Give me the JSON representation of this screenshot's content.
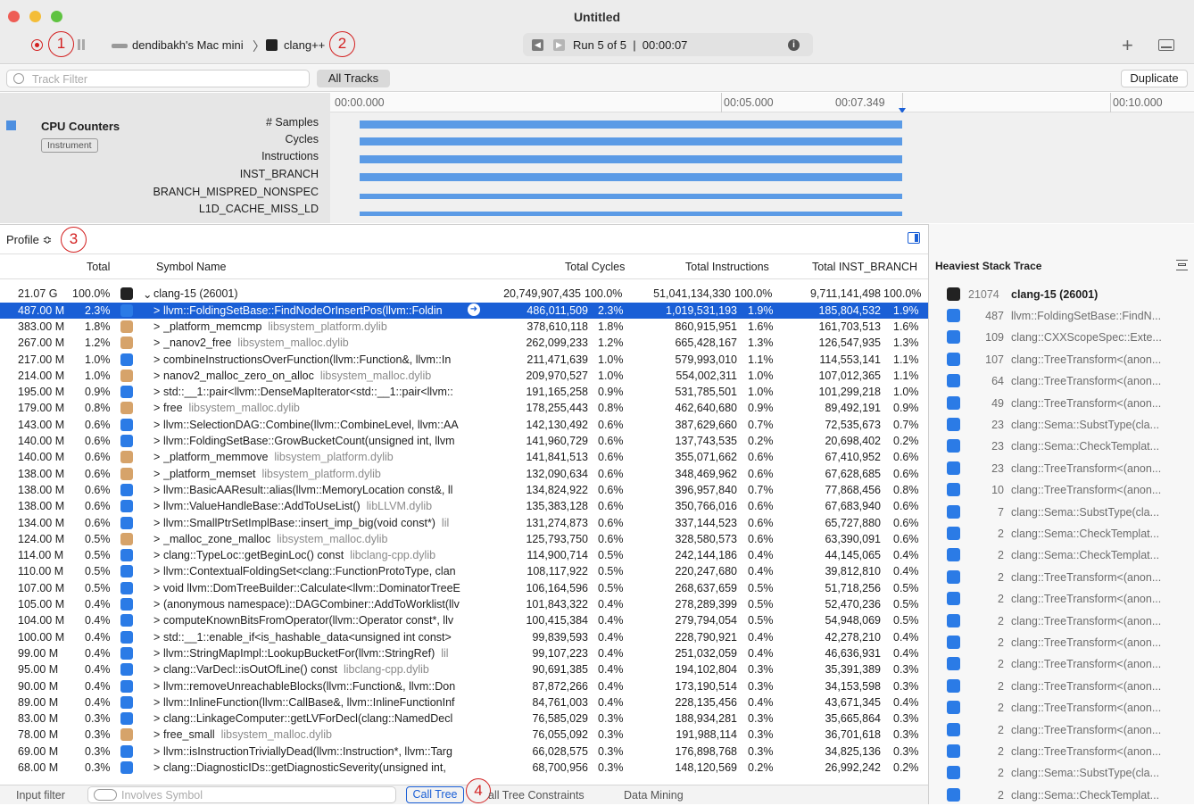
{
  "window": {
    "title": "Untitled"
  },
  "toolbar": {
    "device": "dendibakh's Mac mini",
    "target": "clang++",
    "run_status": "Run 5 of 5  |  00:00:07",
    "add": "+",
    "annot1": "1",
    "annot2": "2"
  },
  "filter": {
    "placeholder": "Track Filter",
    "all_tracks": "All Tracks",
    "duplicate": "Duplicate"
  },
  "timeline": {
    "ticks": [
      "00:00.000",
      "00:05.000",
      "00:07.349",
      "00:10.000"
    ],
    "track": {
      "name": "CPU Counters",
      "badge": "Instrument",
      "counters": [
        "# Samples",
        "Cycles",
        "Instructions",
        "INST_BRANCH",
        "BRANCH_MISPRED_NONSPEC",
        "L1D_CACHE_MISS_LD"
      ]
    }
  },
  "profile": {
    "selector": "Profile ≎",
    "annot3": "3"
  },
  "columns": {
    "total": "Total",
    "symbol": "Symbol Name",
    "cycles": "Total Cycles",
    "instructions": "Total Instructions",
    "branch": "Total INST_BRANCH"
  },
  "root": {
    "total": "21.07 G",
    "pct": "100.0%",
    "symbol": "clang-15 (26001)",
    "cycles": "20,749,907,435",
    "cycles_pct": "100.0%",
    "instr": "51,041,134,330",
    "instr_pct": "100.0%",
    "branch": "9,711,141,498",
    "branch_pct": "100.0%"
  },
  "rows": [
    {
      "total": "487.00 M",
      "pct": "2.3%",
      "icon": "user",
      "sym": "llvm::FoldingSetBase::FindNodeOrInsertPos(llvm::Foldin",
      "lib": "",
      "cyc": "486,011,509",
      "cp": "2.3%",
      "ins": "1,019,531,193",
      "ip": "1.9%",
      "br": "185,804,532",
      "bp": "1.9%"
    },
    {
      "total": "383.00 M",
      "pct": "1.8%",
      "icon": "sys",
      "sym": "_platform_memcmp",
      "lib": "libsystem_platform.dylib",
      "cyc": "378,610,118",
      "cp": "1.8%",
      "ins": "860,915,951",
      "ip": "1.6%",
      "br": "161,703,513",
      "bp": "1.6%"
    },
    {
      "total": "267.00 M",
      "pct": "1.2%",
      "icon": "sys",
      "sym": "_nanov2_free",
      "lib": "libsystem_malloc.dylib",
      "cyc": "262,099,233",
      "cp": "1.2%",
      "ins": "665,428,167",
      "ip": "1.3%",
      "br": "126,547,935",
      "bp": "1.3%"
    },
    {
      "total": "217.00 M",
      "pct": "1.0%",
      "icon": "user",
      "sym": "combineInstructionsOverFunction(llvm::Function&, llvm::In",
      "lib": "",
      "cyc": "211,471,639",
      "cp": "1.0%",
      "ins": "579,993,010",
      "ip": "1.1%",
      "br": "114,553,141",
      "bp": "1.1%"
    },
    {
      "total": "214.00 M",
      "pct": "1.0%",
      "icon": "sys",
      "sym": "nanov2_malloc_zero_on_alloc",
      "lib": "libsystem_malloc.dylib",
      "cyc": "209,970,527",
      "cp": "1.0%",
      "ins": "554,002,311",
      "ip": "1.0%",
      "br": "107,012,365",
      "bp": "1.1%"
    },
    {
      "total": "195.00 M",
      "pct": "0.9%",
      "icon": "user",
      "sym": "std::__1::pair<llvm::DenseMapIterator<std::__1::pair<llvm::",
      "lib": "",
      "cyc": "191,165,258",
      "cp": "0.9%",
      "ins": "531,785,501",
      "ip": "1.0%",
      "br": "101,299,218",
      "bp": "1.0%"
    },
    {
      "total": "179.00 M",
      "pct": "0.8%",
      "icon": "sys",
      "sym": "free",
      "lib": "libsystem_malloc.dylib",
      "cyc": "178,255,443",
      "cp": "0.8%",
      "ins": "462,640,680",
      "ip": "0.9%",
      "br": "89,492,191",
      "bp": "0.9%"
    },
    {
      "total": "143.00 M",
      "pct": "0.6%",
      "icon": "user",
      "sym": "llvm::SelectionDAG::Combine(llvm::CombineLevel, llvm::AA",
      "lib": "",
      "cyc": "142,130,492",
      "cp": "0.6%",
      "ins": "387,629,660",
      "ip": "0.7%",
      "br": "72,535,673",
      "bp": "0.7%"
    },
    {
      "total": "140.00 M",
      "pct": "0.6%",
      "icon": "user",
      "sym": "llvm::FoldingSetBase::GrowBucketCount(unsigned int, llvm",
      "lib": "",
      "cyc": "141,960,729",
      "cp": "0.6%",
      "ins": "137,743,535",
      "ip": "0.2%",
      "br": "20,698,402",
      "bp": "0.2%"
    },
    {
      "total": "140.00 M",
      "pct": "0.6%",
      "icon": "sys",
      "sym": "_platform_memmove",
      "lib": "libsystem_platform.dylib",
      "cyc": "141,841,513",
      "cp": "0.6%",
      "ins": "355,071,662",
      "ip": "0.6%",
      "br": "67,410,952",
      "bp": "0.6%"
    },
    {
      "total": "138.00 M",
      "pct": "0.6%",
      "icon": "sys",
      "sym": "_platform_memset",
      "lib": "libsystem_platform.dylib",
      "cyc": "132,090,634",
      "cp": "0.6%",
      "ins": "348,469,962",
      "ip": "0.6%",
      "br": "67,628,685",
      "bp": "0.6%"
    },
    {
      "total": "138.00 M",
      "pct": "0.6%",
      "icon": "user",
      "sym": "llvm::BasicAAResult::alias(llvm::MemoryLocation const&, ll",
      "lib": "",
      "cyc": "134,824,922",
      "cp": "0.6%",
      "ins": "396,957,840",
      "ip": "0.7%",
      "br": "77,868,456",
      "bp": "0.8%"
    },
    {
      "total": "138.00 M",
      "pct": "0.6%",
      "icon": "user",
      "sym": "llvm::ValueHandleBase::AddToUseList()",
      "lib": "libLLVM.dylib",
      "cyc": "135,383,128",
      "cp": "0.6%",
      "ins": "350,766,016",
      "ip": "0.6%",
      "br": "67,683,940",
      "bp": "0.6%"
    },
    {
      "total": "134.00 M",
      "pct": "0.6%",
      "icon": "user",
      "sym": "llvm::SmallPtrSetImplBase::insert_imp_big(void const*)",
      "lib": "lil",
      "cyc": "131,274,873",
      "cp": "0.6%",
      "ins": "337,144,523",
      "ip": "0.6%",
      "br": "65,727,880",
      "bp": "0.6%"
    },
    {
      "total": "124.00 M",
      "pct": "0.5%",
      "icon": "sys",
      "sym": "_malloc_zone_malloc",
      "lib": "libsystem_malloc.dylib",
      "cyc": "125,793,750",
      "cp": "0.6%",
      "ins": "328,580,573",
      "ip": "0.6%",
      "br": "63,390,091",
      "bp": "0.6%"
    },
    {
      "total": "114.00 M",
      "pct": "0.5%",
      "icon": "user",
      "sym": "clang::TypeLoc::getBeginLoc() const",
      "lib": "libclang-cpp.dylib",
      "cyc": "114,900,714",
      "cp": "0.5%",
      "ins": "242,144,186",
      "ip": "0.4%",
      "br": "44,145,065",
      "bp": "0.4%"
    },
    {
      "total": "110.00 M",
      "pct": "0.5%",
      "icon": "user",
      "sym": "llvm::ContextualFoldingSet<clang::FunctionProtoType, clan",
      "lib": "",
      "cyc": "108,117,922",
      "cp": "0.5%",
      "ins": "220,247,680",
      "ip": "0.4%",
      "br": "39,812,810",
      "bp": "0.4%"
    },
    {
      "total": "107.00 M",
      "pct": "0.5%",
      "icon": "user",
      "sym": "void llvm::DomTreeBuilder::Calculate<llvm::DominatorTreeE",
      "lib": "",
      "cyc": "106,164,596",
      "cp": "0.5%",
      "ins": "268,637,659",
      "ip": "0.5%",
      "br": "51,718,256",
      "bp": "0.5%"
    },
    {
      "total": "105.00 M",
      "pct": "0.4%",
      "icon": "user",
      "sym": "(anonymous namespace)::DAGCombiner::AddToWorklist(llv",
      "lib": "",
      "cyc": "101,843,322",
      "cp": "0.4%",
      "ins": "278,289,399",
      "ip": "0.5%",
      "br": "52,470,236",
      "bp": "0.5%"
    },
    {
      "total": "104.00 M",
      "pct": "0.4%",
      "icon": "user",
      "sym": "computeKnownBitsFromOperator(llvm::Operator const*, llv",
      "lib": "",
      "cyc": "100,415,384",
      "cp": "0.4%",
      "ins": "279,794,054",
      "ip": "0.5%",
      "br": "54,948,069",
      "bp": "0.5%"
    },
    {
      "total": "100.00 M",
      "pct": "0.4%",
      "icon": "user",
      "sym": "std::__1::enable_if<is_hashable_data<unsigned int const>",
      "lib": "",
      "cyc": "99,839,593",
      "cp": "0.4%",
      "ins": "228,790,921",
      "ip": "0.4%",
      "br": "42,278,210",
      "bp": "0.4%"
    },
    {
      "total": "99.00 M",
      "pct": "0.4%",
      "icon": "user",
      "sym": "llvm::StringMapImpl::LookupBucketFor(llvm::StringRef)",
      "lib": "lil",
      "cyc": "99,107,223",
      "cp": "0.4%",
      "ins": "251,032,059",
      "ip": "0.4%",
      "br": "46,636,931",
      "bp": "0.4%"
    },
    {
      "total": "95.00 M",
      "pct": "0.4%",
      "icon": "user",
      "sym": "clang::VarDecl::isOutOfLine() const",
      "lib": "libclang-cpp.dylib",
      "cyc": "90,691,385",
      "cp": "0.4%",
      "ins": "194,102,804",
      "ip": "0.3%",
      "br": "35,391,389",
      "bp": "0.3%"
    },
    {
      "total": "90.00 M",
      "pct": "0.4%",
      "icon": "user",
      "sym": "llvm::removeUnreachableBlocks(llvm::Function&, llvm::Don",
      "lib": "",
      "cyc": "87,872,266",
      "cp": "0.4%",
      "ins": "173,190,514",
      "ip": "0.3%",
      "br": "34,153,598",
      "bp": "0.3%"
    },
    {
      "total": "89.00 M",
      "pct": "0.4%",
      "icon": "user",
      "sym": "llvm::InlineFunction(llvm::CallBase&, llvm::InlineFunctionInf",
      "lib": "",
      "cyc": "84,761,003",
      "cp": "0.4%",
      "ins": "228,135,456",
      "ip": "0.4%",
      "br": "43,671,345",
      "bp": "0.4%"
    },
    {
      "total": "83.00 M",
      "pct": "0.3%",
      "icon": "user",
      "sym": "clang::LinkageComputer::getLVForDecl(clang::NamedDecl",
      "lib": "",
      "cyc": "76,585,029",
      "cp": "0.3%",
      "ins": "188,934,281",
      "ip": "0.3%",
      "br": "35,665,864",
      "bp": "0.3%"
    },
    {
      "total": "78.00 M",
      "pct": "0.3%",
      "icon": "sys",
      "sym": "free_small",
      "lib": "libsystem_malloc.dylib",
      "cyc": "76,055,092",
      "cp": "0.3%",
      "ins": "191,988,114",
      "ip": "0.3%",
      "br": "36,701,618",
      "bp": "0.3%"
    },
    {
      "total": "69.00 M",
      "pct": "0.3%",
      "icon": "user",
      "sym": "llvm::isInstructionTriviallyDead(llvm::Instruction*, llvm::Targ",
      "lib": "",
      "cyc": "66,028,575",
      "cp": "0.3%",
      "ins": "176,898,768",
      "ip": "0.3%",
      "br": "34,825,136",
      "bp": "0.3%"
    },
    {
      "total": "68.00 M",
      "pct": "0.3%",
      "icon": "user",
      "sym": "clang::DiagnosticIDs::getDiagnosticSeverity(unsigned int,",
      "lib": "",
      "cyc": "68,700,956",
      "cp": "0.3%",
      "ins": "148,120,569",
      "ip": "0.2%",
      "br": "26,992,242",
      "bp": "0.2%"
    }
  ],
  "heaviest": {
    "title": "Heaviest Stack Trace",
    "root": {
      "count": "21074",
      "name": "clang-15 (26001)"
    },
    "items": [
      {
        "count": "487",
        "name": "llvm::FoldingSetBase::FindN..."
      },
      {
        "count": "109",
        "name": "clang::CXXScopeSpec::Exte..."
      },
      {
        "count": "107",
        "name": "clang::TreeTransform<(anon..."
      },
      {
        "count": "64",
        "name": "clang::TreeTransform<(anon..."
      },
      {
        "count": "49",
        "name": "clang::TreeTransform<(anon..."
      },
      {
        "count": "23",
        "name": "clang::Sema::SubstType(cla..."
      },
      {
        "count": "23",
        "name": "clang::Sema::CheckTemplat..."
      },
      {
        "count": "23",
        "name": "clang::TreeTransform<(anon..."
      },
      {
        "count": "10",
        "name": "clang::TreeTransform<(anon..."
      },
      {
        "count": "7",
        "name": "clang::Sema::SubstType(cla..."
      },
      {
        "count": "2",
        "name": "clang::Sema::CheckTemplat..."
      },
      {
        "count": "2",
        "name": "clang::Sema::CheckTemplat..."
      },
      {
        "count": "2",
        "name": "clang::TreeTransform<(anon..."
      },
      {
        "count": "2",
        "name": "clang::TreeTransform<(anon..."
      },
      {
        "count": "2",
        "name": "clang::TreeTransform<(anon..."
      },
      {
        "count": "2",
        "name": "clang::TreeTransform<(anon..."
      },
      {
        "count": "2",
        "name": "clang::TreeTransform<(anon..."
      },
      {
        "count": "2",
        "name": "clang::TreeTransform<(anon..."
      },
      {
        "count": "2",
        "name": "clang::TreeTransform<(anon..."
      },
      {
        "count": "2",
        "name": "clang::TreeTransform<(anon..."
      },
      {
        "count": "2",
        "name": "clang::TreeTransform<(anon..."
      },
      {
        "count": "2",
        "name": "clang::Sema::SubstType(cla..."
      },
      {
        "count": "2",
        "name": "clang::Sema::CheckTemplat..."
      }
    ]
  },
  "bottom": {
    "input_filter": "Input filter",
    "involves_placeholder": "Involves Symbol",
    "call_tree": "Call Tree",
    "annot4": "4",
    "constraints": "all Tree Constraints",
    "data_mining": "Data Mining"
  }
}
